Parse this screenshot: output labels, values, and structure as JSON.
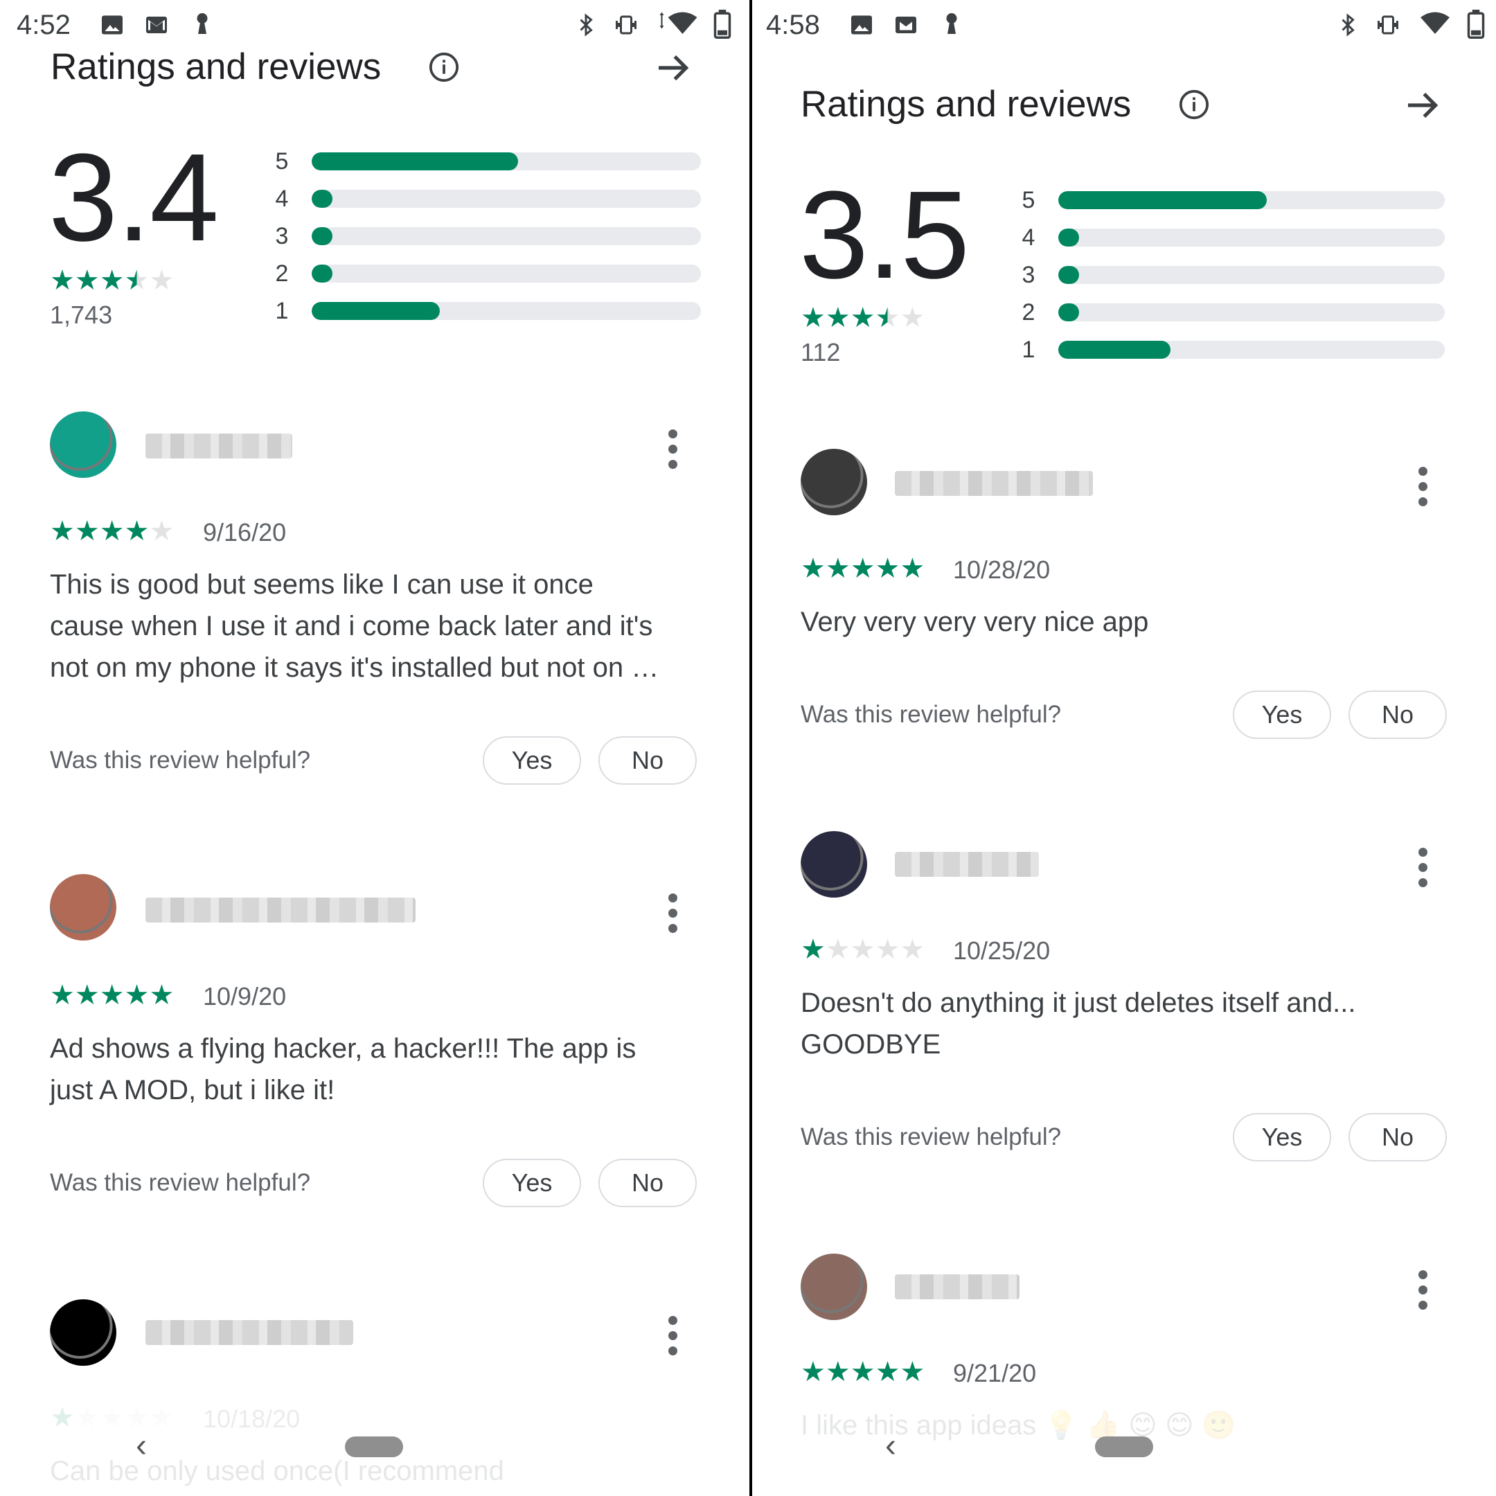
{
  "left": {
    "status": {
      "time": "4:52"
    },
    "header": {
      "title": "Ratings and reviews"
    },
    "summary": {
      "rating": "3.4",
      "count": "1,743",
      "stars_filled": 3.5
    },
    "distribution": [
      {
        "label": "5",
        "fraction": 0.53
      },
      {
        "label": "4",
        "fraction": 0.05
      },
      {
        "label": "3",
        "fraction": 0.04
      },
      {
        "label": "2",
        "fraction": 0.04
      },
      {
        "label": "1",
        "fraction": 0.33
      }
    ],
    "reviews": [
      {
        "stars": 4,
        "date": "9/16/20",
        "text": "This is good but seems like I can use it once cause when I use it and i come back later and it's not on my phone it says it's installed but not on …",
        "helpful": "Was this review helpful?",
        "yes": "Yes",
        "no": "No",
        "avatar_color": "#12a08a"
      },
      {
        "stars": 5,
        "date": "10/9/20",
        "text": "Ad shows a flying hacker, a hacker!!! The app is just A MOD, but i like it!",
        "helpful": "Was this review helpful?",
        "yes": "Yes",
        "no": "No",
        "avatar_color": "#b06a55"
      },
      {
        "stars": 1,
        "date": "10/18/20",
        "text": "Can be only used once(I recommend",
        "avatar_color": "#000000"
      }
    ]
  },
  "right": {
    "status": {
      "time": "4:58"
    },
    "header": {
      "title": "Ratings and reviews"
    },
    "summary": {
      "rating": "3.5",
      "count": "112",
      "stars_filled": 3.5
    },
    "distribution": [
      {
        "label": "5",
        "fraction": 0.54
      },
      {
        "label": "4",
        "fraction": 0.05
      },
      {
        "label": "3",
        "fraction": 0.05
      },
      {
        "label": "2",
        "fraction": 0.05
      },
      {
        "label": "1",
        "fraction": 0.29
      }
    ],
    "reviews": [
      {
        "stars": 5,
        "date": "10/28/20",
        "text": "Very very very very nice app",
        "helpful": "Was this review helpful?",
        "yes": "Yes",
        "no": "No",
        "avatar_color": "#3a3a3a"
      },
      {
        "stars": 1,
        "date": "10/25/20",
        "text": "Doesn't do anything it just deletes itself and... GOODBYE",
        "helpful": "Was this review helpful?",
        "yes": "Yes",
        "no": "No",
        "avatar_color": "#2a2a40"
      },
      {
        "stars": 5,
        "date": "9/21/20",
        "text": "I like this app ideas 💡 👍 😊 😊 🙂",
        "avatar_color": "#8a6a60"
      }
    ]
  },
  "icons": {
    "info": "info-icon",
    "arrow": "arrow-right-icon",
    "more": "more-vert-icon",
    "back": "back-chevron-icon",
    "home": "home-pill"
  }
}
